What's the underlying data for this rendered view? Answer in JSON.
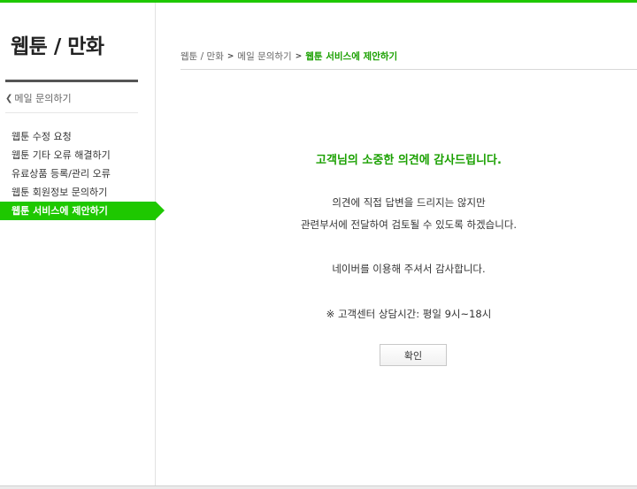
{
  "sidebar": {
    "title": "웹툰 / 만화",
    "back_label": "메일 문의하기",
    "items": [
      {
        "label": "웹툰 수정 요청"
      },
      {
        "label": "웹툰 기타 오류 해결하기"
      },
      {
        "label": "유료상품 등록/관리 오류"
      },
      {
        "label": "웹툰 회원정보 문의하기"
      },
      {
        "label": "웹툰 서비스에 제안하기",
        "active": true
      }
    ]
  },
  "breadcrumb": {
    "items": [
      "웹툰 / 만화",
      "메일 문의하기"
    ],
    "current": "웹툰 서비스에 제안하기"
  },
  "main": {
    "thanks": "고객님의 소중한 의견에 감사드립니다.",
    "line1": "의견에 직접 답변을 드리지는 않지만",
    "line2": "관련부서에 전달하여 검토될 수 있도록 하겠습니다.",
    "line3": "네이버를 이용해 주셔서 감사합니다.",
    "line4": "※ 고객센터 상담시간: 평일 9시~18시",
    "confirm_label": "확인"
  },
  "colors": {
    "accent": "#1ec800",
    "accent_text": "#1aa000"
  }
}
